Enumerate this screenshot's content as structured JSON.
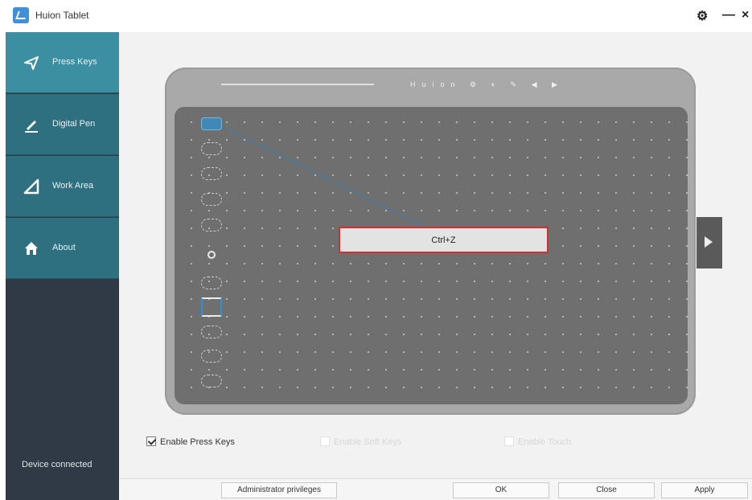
{
  "window": {
    "title": "Huion Tablet",
    "controls": [
      "⚙",
      "—",
      "×"
    ]
  },
  "sidebar": {
    "items": [
      {
        "label": "Press Keys",
        "icon": "send-icon",
        "active": true
      },
      {
        "label": "Digital Pen",
        "icon": "pen-icon",
        "active": false
      },
      {
        "label": "Work Area",
        "icon": "triangle-icon",
        "active": false
      },
      {
        "label": "About",
        "icon": "home-icon",
        "active": false
      }
    ],
    "status": "Device connected"
  },
  "tablet": {
    "top_labels": "Huion ⚙ ◐ ✎ ◀ ▶",
    "callout_value": "Ctrl+Z"
  },
  "options": {
    "enable_press_keys": {
      "label": "Enable Press Keys",
      "checked": true
    },
    "enable_soft_keys": {
      "label": "Enable Soft Keys",
      "checked": false
    },
    "enable_touch": {
      "label": "Enable Touch",
      "checked": false
    }
  },
  "footer": {
    "admin_label": "Administrator privileges",
    "ok_label": "OK",
    "close_label": "Close",
    "apply_label": "Apply"
  },
  "colors": {
    "sidebar_bg": "#2f3a46",
    "sidebar_item": "#2e6f80",
    "sidebar_active": "#3b8fa0",
    "callout_border": "#d32f2f",
    "selected_key": "#3f88b8"
  }
}
